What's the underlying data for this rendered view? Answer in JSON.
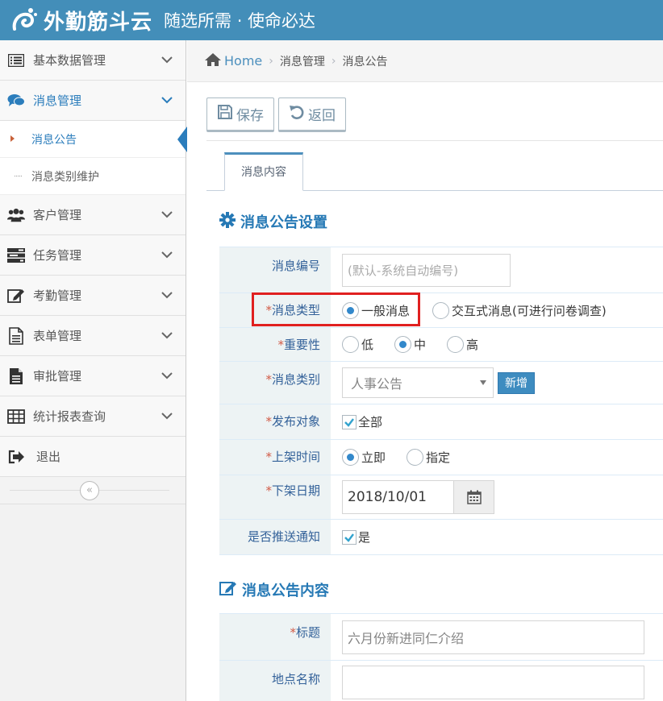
{
  "header": {
    "logo_text": "外勤筋斗云",
    "slogan": "随选所需 · 使命必达",
    "bg_color": "#438eb9"
  },
  "sidebar": {
    "items": [
      {
        "label": "基本数据管理",
        "icon": "list-icon"
      },
      {
        "label": "消息管理",
        "icon": "comments-icon"
      },
      {
        "label": "客户管理",
        "icon": "users-icon"
      },
      {
        "label": "任务管理",
        "icon": "tasks-icon"
      },
      {
        "label": "考勤管理",
        "icon": "edit-icon"
      },
      {
        "label": "表单管理",
        "icon": "file-icon"
      },
      {
        "label": "审批管理",
        "icon": "file-text-icon"
      },
      {
        "label": "统计报表查询",
        "icon": "table-icon"
      },
      {
        "label": "退出",
        "icon": "sign-out-icon"
      }
    ],
    "subitems": [
      {
        "label": "消息公告"
      },
      {
        "label": "消息类别维护"
      }
    ],
    "collapse_symbol": "«"
  },
  "breadcrumb": {
    "home": "Home",
    "items": [
      "消息管理",
      "消息公告"
    ],
    "sep": "›"
  },
  "toolbar": {
    "save_label": "保存",
    "back_label": "返回"
  },
  "tabs": [
    {
      "label": "消息内容"
    }
  ],
  "settings": {
    "title": "消息公告设置",
    "req_mark": "*",
    "fields": {
      "msg_no": {
        "label": "消息编号",
        "placeholder": "(默认-系统自动编号)"
      },
      "msg_type": {
        "label": "消息类型",
        "options": [
          "一般消息",
          "交互式消息(可进行问卷调查)"
        ],
        "selected": "一般消息"
      },
      "importance": {
        "label": "重要性",
        "options": [
          "低",
          "中",
          "高"
        ],
        "selected": "中"
      },
      "category": {
        "label": "消息类别",
        "value": "人事公告",
        "add_label": "新增"
      },
      "audience": {
        "label": "发布对象",
        "option": "全部",
        "checked": true
      },
      "publish_time": {
        "label": "上架时间",
        "options": [
          "立即",
          "指定"
        ],
        "selected": "立即"
      },
      "off_date": {
        "label": "下架日期",
        "value": "2018/10/01"
      },
      "push": {
        "label": "是否推送通知",
        "option": "是",
        "checked": true
      }
    }
  },
  "content": {
    "title": "消息公告内容",
    "fields": {
      "subject": {
        "label": "标题",
        "value": "六月份新进同仁介绍"
      },
      "location": {
        "label": "地点名称",
        "value": ""
      }
    }
  }
}
